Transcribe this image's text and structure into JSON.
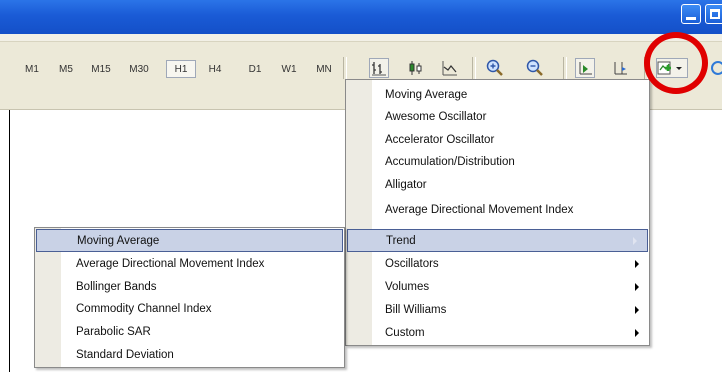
{
  "timeframes": [
    {
      "label": "M1",
      "active": false
    },
    {
      "label": "M5",
      "active": false
    },
    {
      "label": "M15",
      "active": false
    },
    {
      "label": "M30",
      "active": false
    },
    {
      "label": "H1",
      "active": true
    },
    {
      "label": "H4",
      "active": false
    },
    {
      "label": "D1",
      "active": false
    },
    {
      "label": "W1",
      "active": false
    },
    {
      "label": "MN",
      "active": false
    }
  ],
  "toolbar_icons": [
    "bar-chart-icon",
    "candlestick-icon",
    "line-chart-icon",
    "zoom-in-icon",
    "zoom-out-icon",
    "autoscroll-icon",
    "chart-shift-icon",
    "indicators-icon",
    "refresh-icon"
  ],
  "annotation_color": "#e00000",
  "main_menu": {
    "items": [
      {
        "label": "Moving Average",
        "submenu": false
      },
      {
        "label": "Awesome Oscillator",
        "submenu": false
      },
      {
        "label": "Accelerator Oscillator",
        "submenu": false
      },
      {
        "label": "Accumulation/Distribution",
        "submenu": false
      },
      {
        "label": "Alligator",
        "submenu": false
      },
      {
        "label": "Average Directional Movement Index",
        "submenu": false
      },
      {
        "label": "Trend",
        "submenu": true,
        "highlighted": true
      },
      {
        "label": "Oscillators",
        "submenu": true
      },
      {
        "label": "Volumes",
        "submenu": true
      },
      {
        "label": "Bill Williams",
        "submenu": true
      },
      {
        "label": "Custom",
        "submenu": true
      }
    ]
  },
  "trend_submenu": {
    "items": [
      {
        "label": "Moving Average",
        "highlighted": true
      },
      {
        "label": "Average Directional Movement Index"
      },
      {
        "label": "Bollinger Bands"
      },
      {
        "label": "Commodity Channel Index"
      },
      {
        "label": "Parabolic SAR"
      },
      {
        "label": "Standard Deviation"
      }
    ]
  }
}
